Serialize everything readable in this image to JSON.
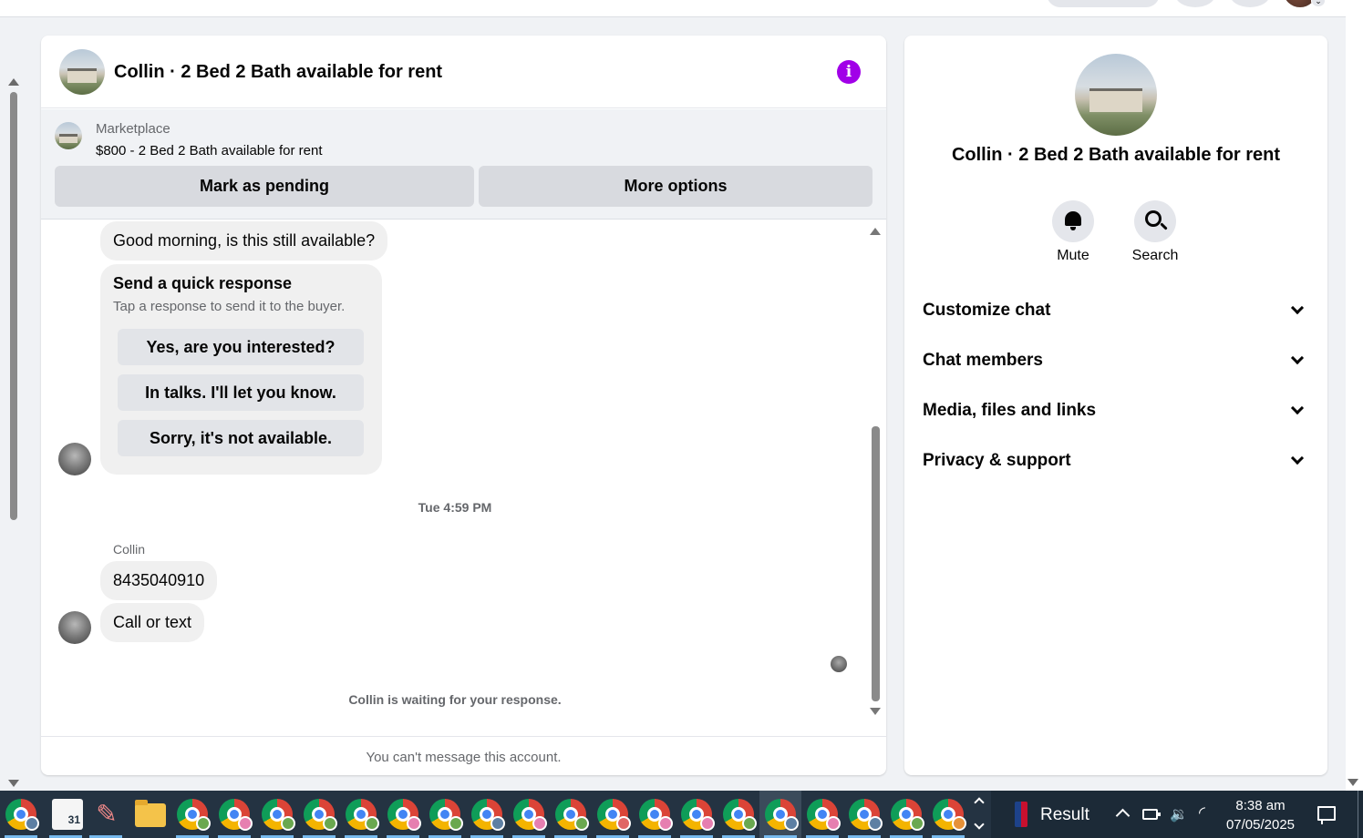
{
  "chat": {
    "title": "Collin · 2 Bed 2 Bath available for rent",
    "listing": {
      "source": "Marketplace",
      "description": "$800 - 2 Bed 2 Bath available for rent",
      "mark_pending_label": "Mark as pending",
      "more_options_label": "More options"
    },
    "messages": {
      "incoming_1": "Good morning, is this still available?",
      "quick_response": {
        "title": "Send a quick response",
        "subtitle": "Tap a response to send it to the buyer.",
        "options": [
          "Yes, are you interested?",
          "In talks. I'll let you know.",
          "Sorry, it's not available."
        ]
      },
      "timestamp": "Tue 4:59 PM",
      "sender": "Collin",
      "incoming_2": "8435040910",
      "incoming_3": "Call or text",
      "waiting": "Collin is waiting for your response."
    },
    "footer": "You can't message this account."
  },
  "info_panel": {
    "title": "Collin · 2 Bed 2 Bath available for rent",
    "actions": {
      "mute": "Mute",
      "search": "Search"
    },
    "sections": [
      "Customize chat",
      "Chat members",
      "Media, files and links",
      "Privacy & support"
    ]
  },
  "taskbar": {
    "calendar_date": "31",
    "tray": {
      "widget_label": "Result",
      "time": "8:38 am",
      "date": "07/05/2025"
    }
  },
  "colors": {
    "info_accent": "#a100e8",
    "page_background": "#f0f2f5",
    "taskbar": "#243342"
  }
}
